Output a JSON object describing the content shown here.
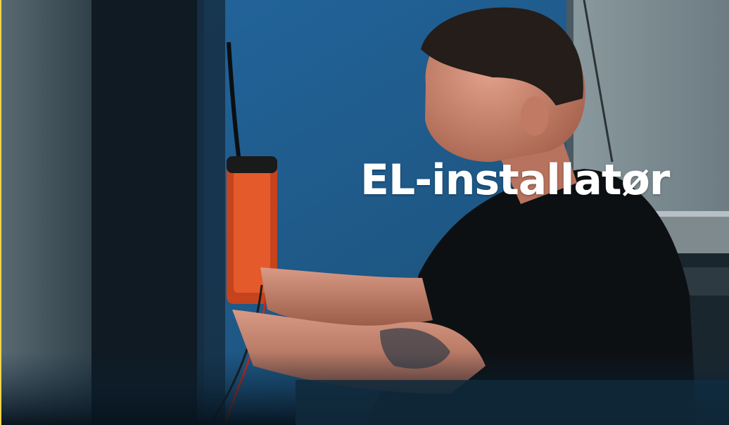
{
  "overlay": {
    "title": "EL-installatør"
  },
  "colors": {
    "wall_blue": "#1f5b86",
    "shirt_black": "#0d1013",
    "device_orange": "#d24a22",
    "edge_yellow": "#f2d64b"
  }
}
